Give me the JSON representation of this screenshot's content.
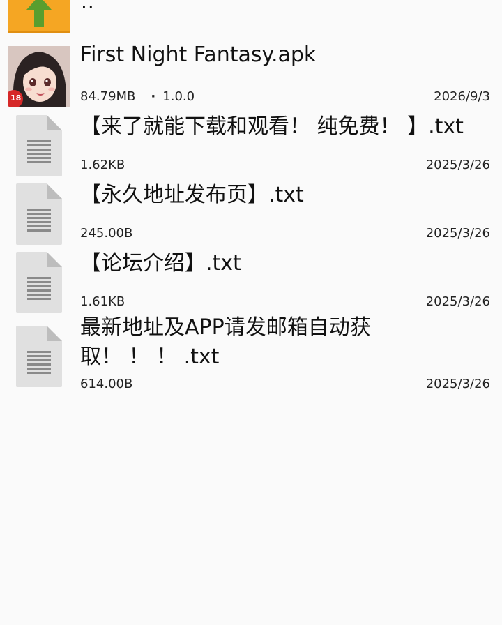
{
  "parent_entry": {
    "label": "..",
    "icon": "folder-up-arrow-icon",
    "icon_color": "#f5a623",
    "arrow_color": "#5a9e2e"
  },
  "files": [
    {
      "name": "First Night Fantasy.apk",
      "size": "84.79MB",
      "version": "1.0.0",
      "date": "2026/9/3",
      "icon": "app-icon",
      "badge": "18"
    },
    {
      "name": "【来了就能下载和观看！ 纯免费！ 】.txt",
      "size": "1.62KB",
      "date": "2025/3/26",
      "icon": "text-file-icon"
    },
    {
      "name": "【永久地址发布页】.txt",
      "size": "245.00B",
      "date": "2025/3/26",
      "icon": "text-file-icon"
    },
    {
      "name": "【论坛介绍】.txt",
      "size": "1.61KB",
      "date": "2025/3/26",
      "icon": "text-file-icon"
    },
    {
      "name": "最新地址及APP请发邮箱自动获取！ ！ ！ .txt",
      "size": "614.00B",
      "date": "2025/3/26",
      "icon": "text-file-icon"
    }
  ]
}
